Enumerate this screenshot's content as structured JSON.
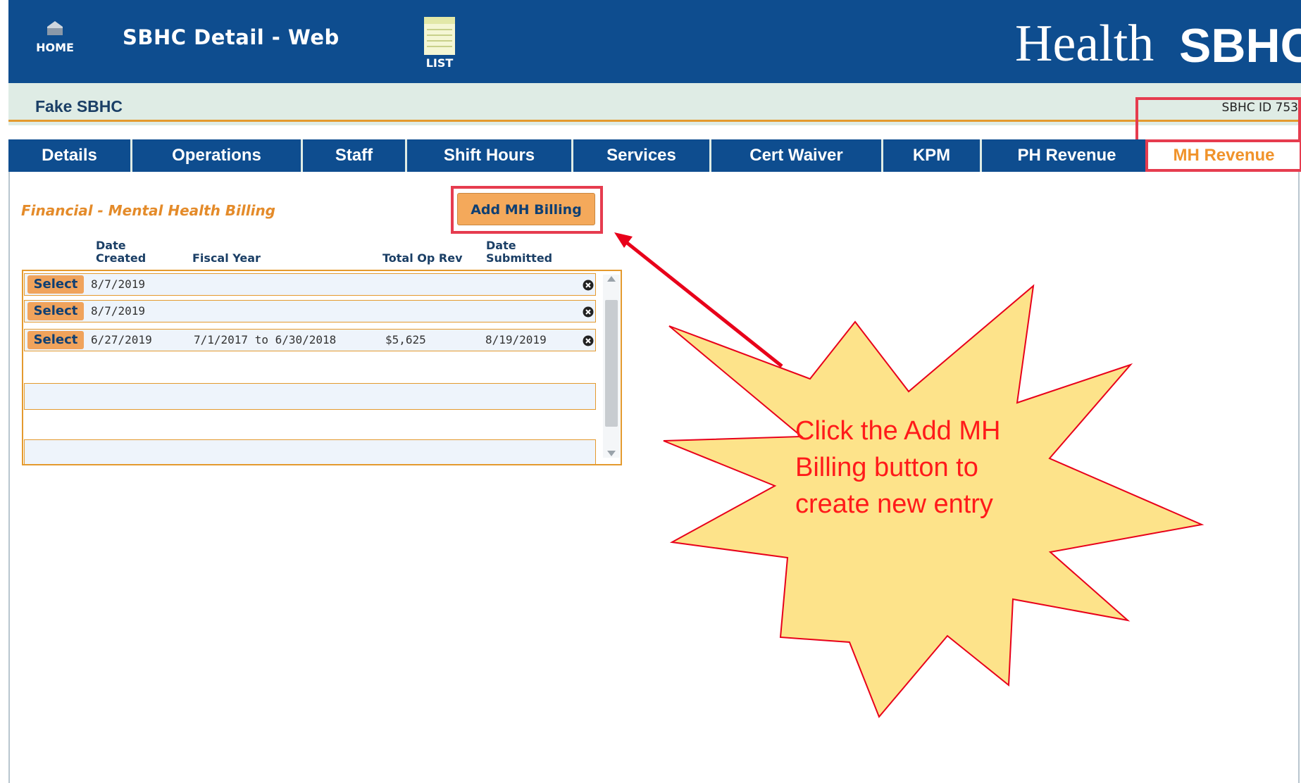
{
  "header": {
    "title": "SBHC Detail - Web",
    "home_label": "HOME",
    "list_label": "LIST",
    "logo_oha": "Health",
    "logo_sbhc": "SBHC"
  },
  "site": {
    "name": "Fake SBHC",
    "id_text": "SBHC ID 753"
  },
  "tabs": [
    {
      "label": "Details"
    },
    {
      "label": "Operations"
    },
    {
      "label": "Staff"
    },
    {
      "label": "Shift Hours"
    },
    {
      "label": "Services"
    },
    {
      "label": "Cert Waiver"
    },
    {
      "label": "KPM"
    },
    {
      "label": "PH Revenue"
    },
    {
      "label": "MH Revenue",
      "active": true
    }
  ],
  "section": {
    "title": "Financial - Mental Health Billing",
    "add_button": "Add MH Billing"
  },
  "columns": {
    "date_created": "Date Created",
    "fiscal_year": "Fiscal Year",
    "total_op_rev": "Total Op Rev",
    "date_submitted": "Date Submitted"
  },
  "rows": [
    {
      "select": "Select",
      "date_created": "8/7/2019",
      "fiscal_year": "",
      "total_op_rev": "",
      "date_submitted": ""
    },
    {
      "select": "Select",
      "date_created": "8/7/2019",
      "fiscal_year": "",
      "total_op_rev": "",
      "date_submitted": ""
    },
    {
      "select": "Select",
      "date_created": "6/27/2019",
      "fiscal_year": "7/1/2017 to 6/30/2018",
      "total_op_rev": "$5,625",
      "date_submitted": "8/19/2019"
    }
  ],
  "callout": {
    "text": "Click the Add MH Billing button to create new entry"
  },
  "colors": {
    "header_blue": "#0e4d8f",
    "accent_orange": "#e49a2e",
    "highlight_red": "#e63c4f",
    "callout_fill": "#fde38a",
    "callout_text": "#ff1a1a"
  }
}
